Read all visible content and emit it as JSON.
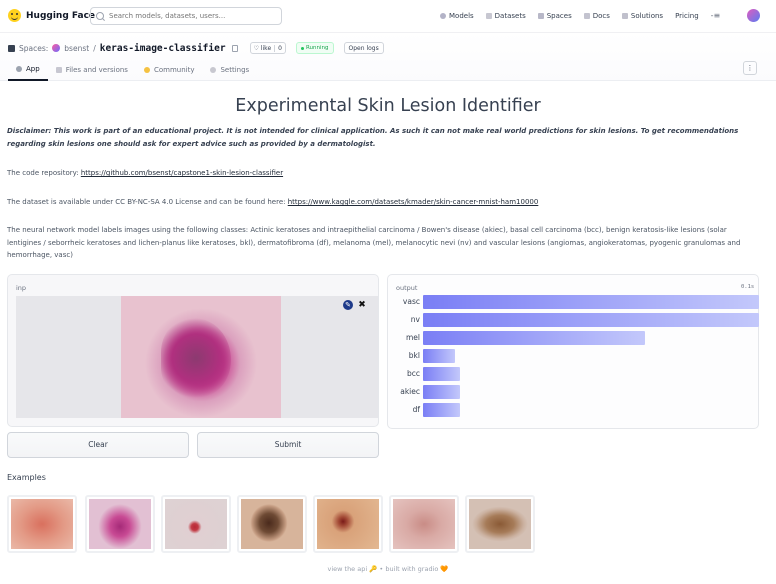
{
  "nav": {
    "brand": "Hugging Face",
    "search_placeholder": "Search models, datasets, users...",
    "links": [
      "Models",
      "Datasets",
      "Spaces",
      "Docs",
      "Solutions"
    ],
    "pricing": "Pricing",
    "menu_glyph": "-≡"
  },
  "space": {
    "spaces_label": "Spaces:",
    "owner": "bsenst",
    "separator": "/",
    "repo": "keras-image-classifier",
    "like_label": "♡ like",
    "like_count": "0",
    "status": "Running",
    "open_logs": "Open logs",
    "tabs": [
      "App",
      "Files and versions",
      "Community",
      "Settings"
    ],
    "kebab": "⋮"
  },
  "main": {
    "title": "Experimental Skin Lesion Identifier",
    "disclaimer": "Disclaimer: This work is part of an educational project. It is not intended for clinical application. As such it can not make real world predictions for skin lesions. To get recommendations regarding skin lesions one should ask for expert advice such as provided by a dermatologist.",
    "repo_prefix": "The code repository: ",
    "repo_url": "https://github.com/bsenst/capstone1-skin-lesion-classifier",
    "dataset_prefix": "The dataset is available under CC BY-NC-SA 4.0 License and can be found here: ",
    "dataset_url": "https://www.kaggle.com/datasets/kmader/skin-cancer-mnist-ham10000",
    "classes_text": "The neural network model labels images using the following classes: Actinic keratoses and intraepithelial carcinoma / Bowen's disease (akiec), basal cell carcinoma (bcc), benign keratosis-like lesions (solar lentigines / seborrheic keratoses and lichen-planus like keratoses, bkl), dermatofibroma (df), melanoma (mel), melanocytic nevi (nv) and vascular lesions (angiomas, angiokeratomas, pyogenic granulomas and hemorrhage, vasc)"
  },
  "input_panel": {
    "label": "inp",
    "edit_glyph": "✎",
    "clear_glyph": "✖"
  },
  "output_panel": {
    "label": "output",
    "timer": "0.1s",
    "bars": [
      {
        "label": "vasc",
        "fraction": 1.0
      },
      {
        "label": "nv",
        "fraction": 1.0
      },
      {
        "label": "mel",
        "fraction": 0.66
      },
      {
        "label": "bkl",
        "fraction": 0.095
      },
      {
        "label": "bcc",
        "fraction": 0.11
      },
      {
        "label": "akiec",
        "fraction": 0.11
      },
      {
        "label": "df",
        "fraction": 0.11
      }
    ]
  },
  "buttons": {
    "clear": "Clear",
    "submit": "Submit"
  },
  "examples": {
    "label": "Examples",
    "count": 7
  },
  "footer": {
    "view_api": "view the api 🔑",
    "dot": "•",
    "built_with": "built with gradio 🧡"
  }
}
